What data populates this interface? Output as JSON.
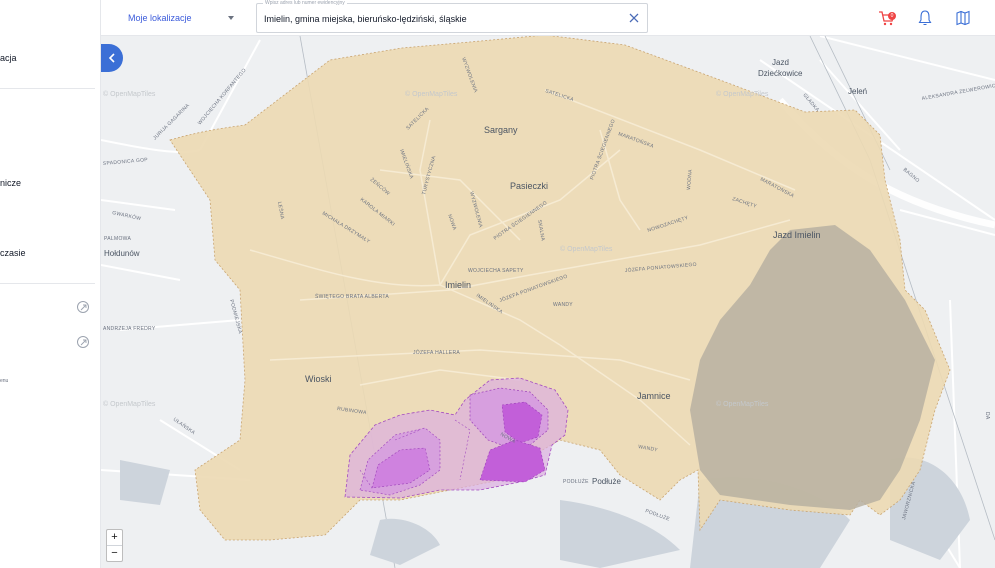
{
  "sidebar": {
    "items": [
      {
        "label": "acja"
      },
      {
        "label": "nicze"
      },
      {
        "label": "czasie"
      }
    ],
    "tiny_text": "enu"
  },
  "topbar": {
    "location_select": "Moje lokalizacje",
    "search": {
      "label": "Wpisz adres lub numer ewidencyjny",
      "value": "Imielin, gmina miejska, bieruńsko-lędziński, śląskie"
    },
    "cart_count": "0"
  },
  "map": {
    "places": {
      "sargany": "Sargany",
      "pasieczki": "Pasieczki",
      "imielin": "Imielin",
      "wioski": "Wioski",
      "jamnice": "Jamnice",
      "jazd_imielin": "Jazd Imielin",
      "jazd": "Jazd",
      "dzieckowice": "Dziećkowice",
      "jelen": "Jeleń",
      "holdunow": "Hołdunów",
      "podluze": "Podłuże"
    },
    "watermark": "© OpenMapTiles",
    "streets": {
      "wyzwolenia_n": "WYZWOLENIA",
      "satelicka": "SATELICKA",
      "satelicka2": "SATELICKA",
      "maratonska": "MARATOŃSKA",
      "piotra_sciegiennego": "PIOTRA ŚCIEGIENNEGO",
      "wodna": "WODNA",
      "maratonska2": "MARATOŃSKA",
      "zachety": "ZACHĘTY",
      "nowozachety": "NOWOZACHĘTY",
      "imielinska": "IMIELIŃSKA",
      "turystyczna": "TURYSTYCZNA",
      "zencow": "ŻEŃCÓW",
      "karola_miarki": "KAROLA MIARKI",
      "michala_drzymaly": "MICHAŁA DRZYMAŁY",
      "wyzwolenia": "WYZWOLENIA",
      "nowa": "NOWA",
      "piotra_sciegiennego2": "PIOTRA ŚCIEGIENNEGO",
      "skalna": "SKALNA",
      "wojciecha_sapety": "WOJCIECHA SAPETY",
      "jozefa_poniatowskiego": "JÓZEFA PONIATOWSKIEGO",
      "jozefa_poniatowskiego2": "JÓZEFA PONIATOWSKIEGO",
      "wandy": "WANDY",
      "wandy2": "WANDY",
      "imielinska2": "IMIELIŃSKA",
      "swietego_brata_alberta": "ŚWIĘTEGO BRATA ALBERTA",
      "jozefa_hallera": "JÓZEFA HALLERA",
      "rubinowa": "RUBINOWA",
      "nowa2": "NOWA",
      "podluze_st": "PODŁUŻE",
      "podluze_st2": "PODŁUŻE",
      "podmiejska": "PODMIEJSKA",
      "lesna": "LEŚNA",
      "gwarkow": "GWARKÓW",
      "palmowa": "PALMOWA",
      "ulanska": "UŁAŃSKA",
      "jurija_gagarina": "JURIJA GAGARINA",
      "wojciecha_korfantego": "WOJCIECHA KORFANTEGO",
      "spadonica_gop": "SPADONICA GOP",
      "andrzeja_fredry": "ANDRZEJA FREDRY",
      "aleksandra_zelwerowicza": "ALEKSANDRA ZELWEROWICZA",
      "bagno": "BAGNO",
      "jaworznicka": "JAWORZNICKA",
      "gladka": "GŁADKA",
      "da": "DA"
    },
    "colors": {
      "municipality_fill": "#ecd9b2",
      "municipality_border": "#b8956a",
      "heat": "#c159d8",
      "heat_line": "#9b3fb8",
      "lake": "#cdd4dc",
      "accent": "#3b6fd6"
    }
  },
  "controls": {
    "zoom_in": "+",
    "zoom_out": "−"
  }
}
